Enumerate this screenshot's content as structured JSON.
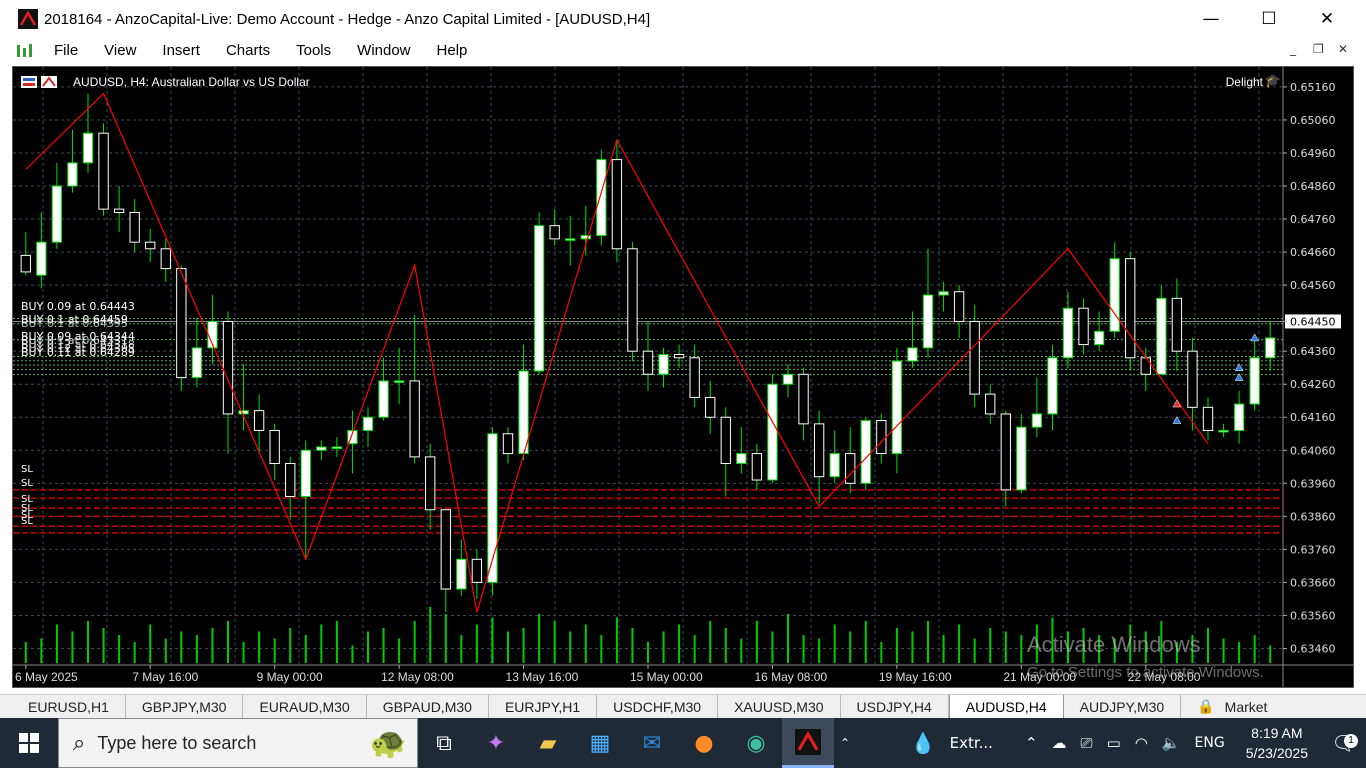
{
  "window": {
    "title": "2018164 - AnzoCapital-Live: Demo Account - Hedge - Anzo Capital Limited - [AUDUSD,H4]",
    "min": "—",
    "max": "☐",
    "close": "✕"
  },
  "menu": [
    "File",
    "View",
    "Insert",
    "Charts",
    "Tools",
    "Window",
    "Help"
  ],
  "mdi_buttons": [
    "_",
    "❐",
    "✕"
  ],
  "chart": {
    "symbol_label": "AUDUSD, H4:  Australian Dollar vs US Dollar",
    "ea_name": "Delight",
    "ea_icon": "graduation-cap-icon",
    "current_price": "0.64450",
    "buy_labels": [
      "BUY 0.09 at 0.64443",
      "BUY 0.1 at 0.64459",
      "BUY 0.1 at 0.64395",
      "BUY 0.09 at 0.64344",
      "BUY 0.1 at 0.64331",
      "BUY 0.12 at 0.64318",
      "BUY 0.12 at 0.64305",
      "BUY 0.11 at 0.64289"
    ],
    "sl_labels": [
      "SL",
      "SL",
      "SL",
      "SL",
      "SL",
      "SL"
    ],
    "colors": {
      "background": "#000000",
      "grid": "#3a4a5a",
      "bull_body": "#ffffff",
      "bear_body": "#000000",
      "wick": "#00e000",
      "zigzag": "#ff0000",
      "volume": "#00cc00",
      "buy_line": "#66aa66",
      "sl_line": "#cc0000"
    }
  },
  "chart_data": {
    "type": "candlestick",
    "symbol": "AUDUSD",
    "timeframe": "H4",
    "y_ticks": [
      "0.65160",
      "0.65060",
      "0.64960",
      "0.64860",
      "0.64760",
      "0.64660",
      "0.64560",
      "0.64450",
      "0.64360",
      "0.64260",
      "0.64160",
      "0.64060",
      "0.63960",
      "0.63860",
      "0.63760",
      "0.63660",
      "0.63560",
      "0.63460"
    ],
    "ylim": [
      0.6341,
      0.6519
    ],
    "x_ticks": [
      "6 May 2025",
      "7 May 16:00",
      "9 May 00:00",
      "12 May 08:00",
      "13 May 16:00",
      "15 May 00:00",
      "16 May 08:00",
      "19 May 16:00",
      "21 May 00:00",
      "22 May 08:00"
    ],
    "candles": [
      [
        0.6465,
        0.646,
        0.6472,
        0.6459
      ],
      [
        0.6459,
        0.6469,
        0.6478,
        0.6455
      ],
      [
        0.6469,
        0.6486,
        0.6493,
        0.6467
      ],
      [
        0.6486,
        0.6493,
        0.6503,
        0.6484
      ],
      [
        0.6493,
        0.6502,
        0.6514,
        0.649
      ],
      [
        0.6502,
        0.6479,
        0.6505,
        0.6477
      ],
      [
        0.6479,
        0.6478,
        0.6486,
        0.6472
      ],
      [
        0.6478,
        0.6469,
        0.6482,
        0.6466
      ],
      [
        0.6469,
        0.6467,
        0.6473,
        0.6463
      ],
      [
        0.6467,
        0.6461,
        0.647,
        0.6457
      ],
      [
        0.6461,
        0.6428,
        0.6462,
        0.6424
      ],
      [
        0.6428,
        0.6437,
        0.6446,
        0.6425
      ],
      [
        0.6437,
        0.6445,
        0.6453,
        0.6432
      ],
      [
        0.6445,
        0.6417,
        0.6448,
        0.6405
      ],
      [
        0.6417,
        0.6418,
        0.6432,
        0.6412
      ],
      [
        0.6418,
        0.6412,
        0.6423,
        0.6405
      ],
      [
        0.6412,
        0.6402,
        0.6414,
        0.6397
      ],
      [
        0.6402,
        0.6392,
        0.6404,
        0.6385
      ],
      [
        0.6392,
        0.6406,
        0.6409,
        0.6373
      ],
      [
        0.6406,
        0.6407,
        0.6409,
        0.6403
      ],
      [
        0.6407,
        0.6407,
        0.641,
        0.6404
      ],
      [
        0.6408,
        0.6412,
        0.6418,
        0.6399
      ],
      [
        0.6412,
        0.6416,
        0.6419,
        0.6407
      ],
      [
        0.6416,
        0.6427,
        0.6434,
        0.6415
      ],
      [
        0.6427,
        0.6427,
        0.6437,
        0.642
      ],
      [
        0.6427,
        0.6404,
        0.6447,
        0.6402
      ],
      [
        0.6404,
        0.6388,
        0.6408,
        0.6382
      ],
      [
        0.6388,
        0.6364,
        0.6388,
        0.6357
      ],
      [
        0.6364,
        0.6373,
        0.6379,
        0.6362
      ],
      [
        0.6373,
        0.6366,
        0.6376,
        0.6361
      ],
      [
        0.6366,
        0.6411,
        0.6413,
        0.6362
      ],
      [
        0.6411,
        0.6405,
        0.6413,
        0.6402
      ],
      [
        0.6405,
        0.643,
        0.6438,
        0.6403
      ],
      [
        0.643,
        0.6474,
        0.6478,
        0.6429
      ],
      [
        0.6474,
        0.647,
        0.6479,
        0.6468
      ],
      [
        0.647,
        0.647,
        0.6477,
        0.6462
      ],
      [
        0.647,
        0.6471,
        0.648,
        0.6465
      ],
      [
        0.6471,
        0.6494,
        0.6497,
        0.6468
      ],
      [
        0.6494,
        0.6467,
        0.65,
        0.6463
      ],
      [
        0.6467,
        0.6436,
        0.6469,
        0.6433
      ],
      [
        0.6436,
        0.6429,
        0.6445,
        0.6424
      ],
      [
        0.6429,
        0.6435,
        0.6437,
        0.6425
      ],
      [
        0.6435,
        0.6434,
        0.6438,
        0.6431
      ],
      [
        0.6434,
        0.6422,
        0.6438,
        0.6419
      ],
      [
        0.6422,
        0.6416,
        0.6427,
        0.6411
      ],
      [
        0.6416,
        0.6402,
        0.6419,
        0.6392
      ],
      [
        0.6402,
        0.6405,
        0.6413,
        0.6399
      ],
      [
        0.6405,
        0.6397,
        0.6408,
        0.6394
      ],
      [
        0.6397,
        0.6426,
        0.6429,
        0.6396
      ],
      [
        0.6426,
        0.6429,
        0.6432,
        0.6422
      ],
      [
        0.6429,
        0.6414,
        0.6431,
        0.6409
      ],
      [
        0.6414,
        0.6398,
        0.6418,
        0.639
      ],
      [
        0.6398,
        0.6405,
        0.6412,
        0.6396
      ],
      [
        0.6405,
        0.6396,
        0.6413,
        0.6393
      ],
      [
        0.6396,
        0.6415,
        0.6416,
        0.6394
      ],
      [
        0.6415,
        0.6405,
        0.6417,
        0.6402
      ],
      [
        0.6405,
        0.6433,
        0.6437,
        0.6399
      ],
      [
        0.6433,
        0.6437,
        0.6448,
        0.6431
      ],
      [
        0.6437,
        0.6453,
        0.6467,
        0.6434
      ],
      [
        0.6453,
        0.6454,
        0.6457,
        0.6448
      ],
      [
        0.6454,
        0.6445,
        0.6456,
        0.644
      ],
      [
        0.6445,
        0.6423,
        0.645,
        0.6419
      ],
      [
        0.6423,
        0.6417,
        0.6426,
        0.6414
      ],
      [
        0.6417,
        0.6394,
        0.6418,
        0.6389
      ],
      [
        0.6394,
        0.6413,
        0.6417,
        0.6393
      ],
      [
        0.6413,
        0.6417,
        0.6428,
        0.641
      ],
      [
        0.6417,
        0.6434,
        0.6438,
        0.6412
      ],
      [
        0.6434,
        0.6449,
        0.6454,
        0.6431
      ],
      [
        0.6449,
        0.6438,
        0.6452,
        0.6435
      ],
      [
        0.6438,
        0.6442,
        0.6448,
        0.6436
      ],
      [
        0.6442,
        0.6464,
        0.6469,
        0.644
      ],
      [
        0.6464,
        0.6434,
        0.6466,
        0.643
      ],
      [
        0.6434,
        0.6429,
        0.6437,
        0.6424
      ],
      [
        0.6429,
        0.6452,
        0.6456,
        0.6429
      ],
      [
        0.6452,
        0.6436,
        0.6458,
        0.643
      ],
      [
        0.6436,
        0.6419,
        0.644,
        0.6412
      ],
      [
        0.6419,
        0.6412,
        0.6422,
        0.6409
      ],
      [
        0.6412,
        0.6412,
        0.6414,
        0.641
      ],
      [
        0.6412,
        0.642,
        0.6424,
        0.6408
      ],
      [
        0.642,
        0.6434,
        0.644,
        0.6418
      ],
      [
        0.6434,
        0.644,
        0.6445,
        0.643
      ]
    ],
    "volumes": [
      0.3,
      0.35,
      0.55,
      0.45,
      0.6,
      0.5,
      0.4,
      0.3,
      0.55,
      0.35,
      0.45,
      0.4,
      0.5,
      0.6,
      0.3,
      0.45,
      0.35,
      0.5,
      0.4,
      0.55,
      0.6,
      0.25,
      0.45,
      0.5,
      0.35,
      0.6,
      0.8,
      0.7,
      0.4,
      0.55,
      0.65,
      0.45,
      0.5,
      0.7,
      0.6,
      0.45,
      0.55,
      0.4,
      0.65,
      0.5,
      0.3,
      0.45,
      0.55,
      0.4,
      0.6,
      0.5,
      0.35,
      0.6,
      0.45,
      0.7,
      0.4,
      0.35,
      0.55,
      0.45,
      0.6,
      0.3,
      0.5,
      0.45,
      0.6,
      0.4,
      0.55,
      0.35,
      0.5,
      0.45,
      0.4,
      0.55,
      0.65,
      0.45,
      0.5,
      0.4,
      0.35,
      0.55,
      0.45,
      0.6,
      0.3,
      0.4,
      0.5,
      0.35,
      0.3,
      0.4,
      0.25
    ],
    "zigzag": [
      [
        0,
        0.6491
      ],
      [
        5,
        0.6514
      ],
      [
        18,
        0.6373
      ],
      [
        25,
        0.6462
      ],
      [
        29,
        0.6357
      ],
      [
        38,
        0.65
      ],
      [
        51,
        0.6389
      ],
      [
        67,
        0.6467
      ],
      [
        76,
        0.6408
      ]
    ],
    "buy_levels": [
      0.64443,
      0.64459,
      0.64395,
      0.64344,
      0.64331,
      0.64318,
      0.64305,
      0.64289
    ],
    "sl_levels": [
      0.6394,
      0.63915,
      0.63885,
      0.6386,
      0.6383,
      0.6381
    ],
    "current_price": 0.6445
  },
  "tabs": [
    "EURUSD,H1",
    "GBPJPY,M30",
    "EURAUD,M30",
    "GBPAUD,M30",
    "EURJPY,H1",
    "USDCHF,M30",
    "XAUUSD,M30",
    "USDJPY,H4",
    "AUDUSD,H4",
    "AUDJPY,M30"
  ],
  "active_tab": "AUDUSD,H4",
  "market_tab": "Market",
  "watermark": {
    "title": "Activate Windows",
    "subtitle": "Go to Settings to activate Windows."
  },
  "taskbar": {
    "search_placeholder": "Type here to search",
    "pinned": [
      "task-view-icon",
      "copilot-icon",
      "file-explorer-icon",
      "store-icon",
      "outlook-icon",
      "firefox-icon",
      "edge-icon",
      "anzo-metatrader-icon"
    ],
    "tray_app_label": "Extr...",
    "language": "ENG",
    "time": "8:19 AM",
    "date": "5/23/2025",
    "notifications": "1"
  }
}
